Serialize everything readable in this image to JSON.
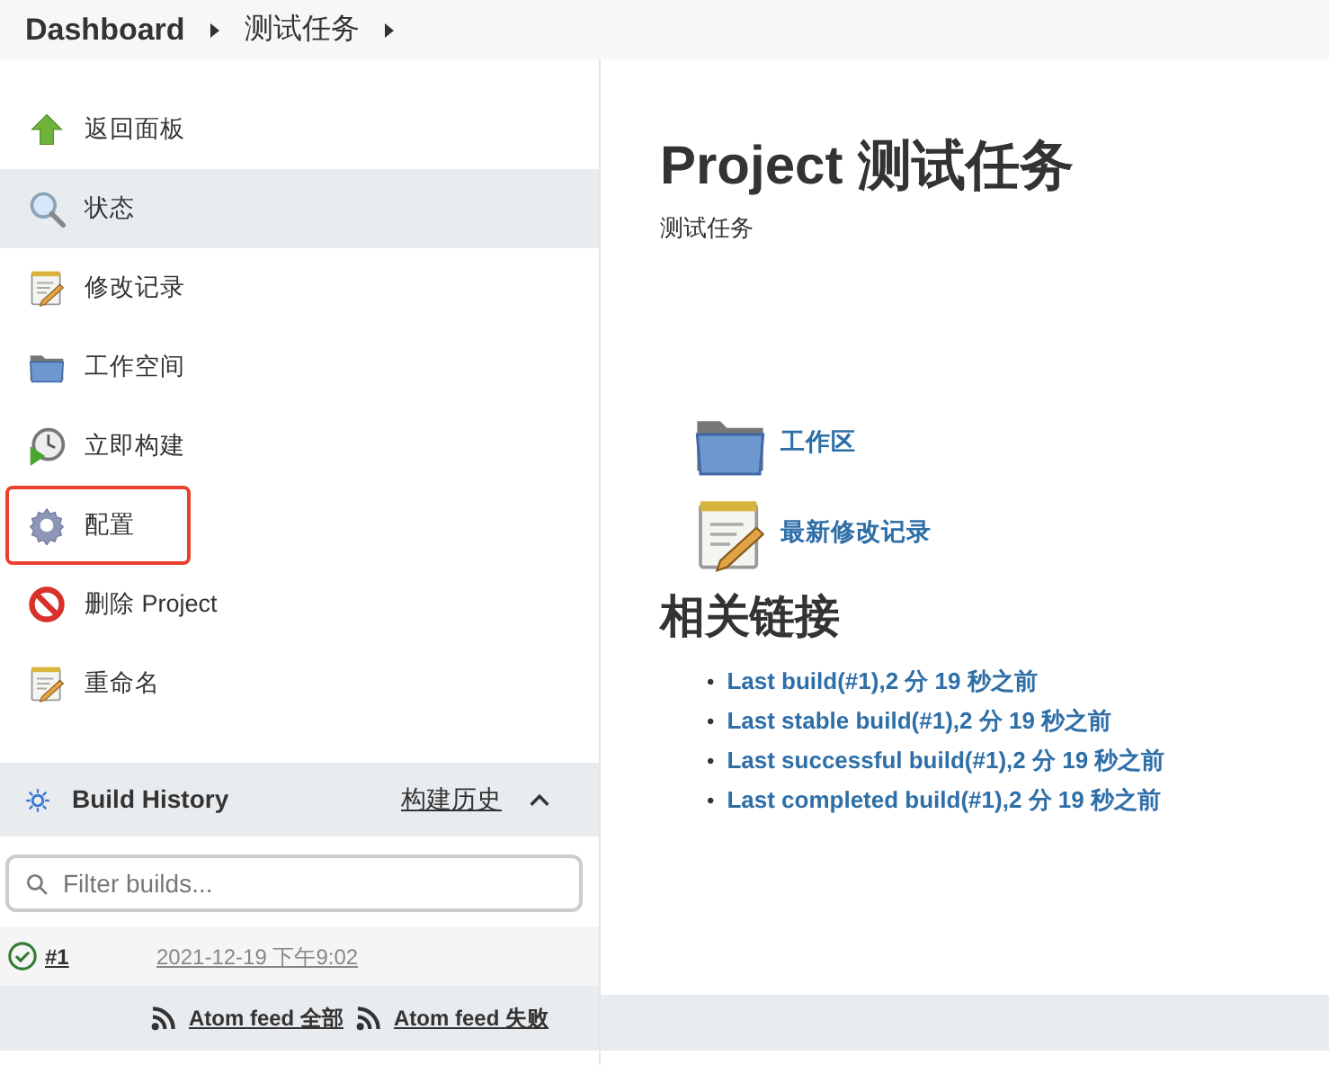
{
  "breadcrumb": [
    {
      "label": "Dashboard"
    },
    {
      "label": "测试任务"
    }
  ],
  "sidebar": {
    "items": [
      {
        "label": "返回面板",
        "selected": false,
        "highlighted": false
      },
      {
        "label": "状态",
        "selected": true,
        "highlighted": false
      },
      {
        "label": "修改记录",
        "selected": false,
        "highlighted": false
      },
      {
        "label": "工作空间",
        "selected": false,
        "highlighted": false
      },
      {
        "label": "立即构建",
        "selected": false,
        "highlighted": false
      },
      {
        "label": "配置",
        "selected": false,
        "highlighted": true
      },
      {
        "label": "删除 Project",
        "selected": false,
        "highlighted": false
      },
      {
        "label": "重命名",
        "selected": false,
        "highlighted": false
      }
    ]
  },
  "build_history": {
    "title": "Build History",
    "link": "构建历史",
    "expanded": true,
    "filter": {
      "placeholder": "Filter builds..."
    },
    "builds": [
      {
        "number": "#1",
        "time": "2021-12-19 下午9:02",
        "success": true
      }
    ],
    "feeds": [
      "Atom feed 全部",
      "Atom feed 失败"
    ]
  },
  "main": {
    "title": "Project 测试任务",
    "description": "测试任务",
    "links": [
      {
        "label": "工作区"
      },
      {
        "label": "最新修改记录"
      }
    ],
    "related_heading": "相关链接",
    "related_links": [
      {
        "bullet": "•",
        "label": "Last build(#1),2 分 19 秒之前"
      },
      {
        "bullet": "•",
        "label": "Last stable build(#1),2 分 19 秒之前"
      },
      {
        "bullet": "•",
        "label": "Last successful build(#1),2 分 19 秒之前"
      },
      {
        "bullet": "•",
        "label": "Last completed build(#1),2 分 19 秒之前"
      }
    ]
  }
}
